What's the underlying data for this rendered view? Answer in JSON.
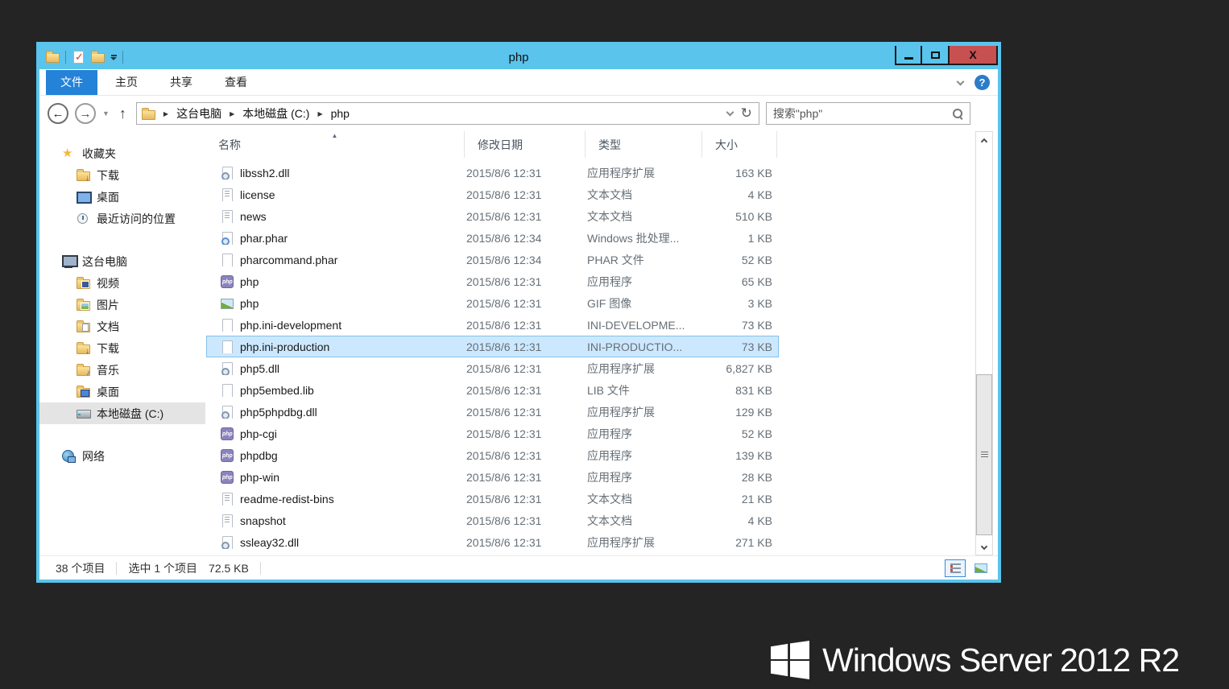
{
  "window": {
    "title": "php"
  },
  "titlebar": {
    "qat_icons": [
      "window-folder-icon",
      "properties-check-icon",
      "new-folder-icon",
      "qat-dropdown-caret"
    ],
    "controls": [
      "minimize",
      "maximize",
      "close"
    ]
  },
  "tabs": [
    {
      "label": "文件",
      "active": true
    },
    {
      "label": "主页",
      "active": false
    },
    {
      "label": "共享",
      "active": false
    },
    {
      "label": "查看",
      "active": false
    }
  ],
  "nav": {
    "breadcrumb": [
      "这台电脑",
      "本地磁盘 (C:)",
      "php"
    ],
    "search_placeholder": "搜索\"php\""
  },
  "sidebar": {
    "items": [
      {
        "label": "收藏夹",
        "icon": "star",
        "level": 0,
        "section": false,
        "selected": false
      },
      {
        "label": "下载",
        "icon": "folder-down",
        "level": 1,
        "section": false,
        "selected": false
      },
      {
        "label": "桌面",
        "icon": "monitor",
        "level": 1,
        "section": false,
        "selected": false
      },
      {
        "label": "最近访问的位置",
        "icon": "recent",
        "level": 1,
        "section": false,
        "selected": false
      },
      {
        "label": "这台电脑",
        "icon": "computer",
        "level": 0,
        "section": true,
        "selected": false
      },
      {
        "label": "视频",
        "icon": "folder-video",
        "level": 1,
        "section": false,
        "selected": false
      },
      {
        "label": "图片",
        "icon": "folder-pic",
        "level": 1,
        "section": false,
        "selected": false
      },
      {
        "label": "文档",
        "icon": "folder-doc",
        "level": 1,
        "section": false,
        "selected": false
      },
      {
        "label": "下载",
        "icon": "folder-down",
        "level": 1,
        "section": false,
        "selected": false
      },
      {
        "label": "音乐",
        "icon": "folder-music",
        "level": 1,
        "section": false,
        "selected": false
      },
      {
        "label": "桌面",
        "icon": "folder-desktop",
        "level": 1,
        "section": false,
        "selected": false
      },
      {
        "label": "本地磁盘 (C:)",
        "icon": "drive",
        "level": 1,
        "section": false,
        "selected": true
      },
      {
        "label": "网络",
        "icon": "network",
        "level": 0,
        "section": true,
        "selected": false
      }
    ]
  },
  "filelist": {
    "columns": [
      {
        "label": "名称",
        "sort": "asc"
      },
      {
        "label": "修改日期",
        "sort": null
      },
      {
        "label": "类型",
        "sort": null
      },
      {
        "label": "大小",
        "sort": null
      }
    ],
    "rows": [
      {
        "name": "libssh2.dll",
        "date": "2015/8/6 12:31",
        "type": "应用程序扩展",
        "size": "163 KB",
        "icon": "dll",
        "selected": false
      },
      {
        "name": "license",
        "date": "2015/8/6 12:31",
        "type": "文本文档",
        "size": "4 KB",
        "icon": "txt",
        "selected": false
      },
      {
        "name": "news",
        "date": "2015/8/6 12:31",
        "type": "文本文档",
        "size": "510 KB",
        "icon": "txt",
        "selected": false
      },
      {
        "name": "phar.phar",
        "date": "2015/8/6 12:34",
        "type": "Windows 批处理...",
        "size": "1 KB",
        "icon": "gearblue",
        "selected": false
      },
      {
        "name": "pharcommand.phar",
        "date": "2015/8/6 12:34",
        "type": "PHAR 文件",
        "size": "52 KB",
        "icon": "file",
        "selected": false
      },
      {
        "name": "php",
        "date": "2015/8/6 12:31",
        "type": "应用程序",
        "size": "65 KB",
        "icon": "php",
        "selected": false
      },
      {
        "name": "php",
        "date": "2015/8/6 12:31",
        "type": "GIF 图像",
        "size": "3 KB",
        "icon": "img",
        "selected": false
      },
      {
        "name": "php.ini-development",
        "date": "2015/8/6 12:31",
        "type": "INI-DEVELOPME...",
        "size": "73 KB",
        "icon": "file",
        "selected": false
      },
      {
        "name": "php.ini-production",
        "date": "2015/8/6 12:31",
        "type": "INI-PRODUCTIO...",
        "size": "73 KB",
        "icon": "file",
        "selected": true
      },
      {
        "name": "php5.dll",
        "date": "2015/8/6 12:31",
        "type": "应用程序扩展",
        "size": "6,827 KB",
        "icon": "dll",
        "selected": false
      },
      {
        "name": "php5embed.lib",
        "date": "2015/8/6 12:31",
        "type": "LIB 文件",
        "size": "831 KB",
        "icon": "file",
        "selected": false
      },
      {
        "name": "php5phpdbg.dll",
        "date": "2015/8/6 12:31",
        "type": "应用程序扩展",
        "size": "129 KB",
        "icon": "dll",
        "selected": false
      },
      {
        "name": "php-cgi",
        "date": "2015/8/6 12:31",
        "type": "应用程序",
        "size": "52 KB",
        "icon": "php",
        "selected": false
      },
      {
        "name": "phpdbg",
        "date": "2015/8/6 12:31",
        "type": "应用程序",
        "size": "139 KB",
        "icon": "php",
        "selected": false
      },
      {
        "name": "php-win",
        "date": "2015/8/6 12:31",
        "type": "应用程序",
        "size": "28 KB",
        "icon": "php",
        "selected": false
      },
      {
        "name": "readme-redist-bins",
        "date": "2015/8/6 12:31",
        "type": "文本文档",
        "size": "21 KB",
        "icon": "txt",
        "selected": false
      },
      {
        "name": "snapshot",
        "date": "2015/8/6 12:31",
        "type": "文本文档",
        "size": "4 KB",
        "icon": "txt",
        "selected": false
      },
      {
        "name": "ssleay32.dll",
        "date": "2015/8/6 12:31",
        "type": "应用程序扩展",
        "size": "271 KB",
        "icon": "dll",
        "selected": false
      }
    ]
  },
  "statusbar": {
    "items_count": "38 个项目",
    "selection": "选中 1 个项目",
    "selection_size": "72.5 KB"
  },
  "branding": {
    "text": "Windows Server 2012 R2"
  },
  "colors": {
    "titlebar_blue": "#5ac4ec",
    "active_tab_blue": "#2482d8",
    "selection_bg": "#cce8ff",
    "selection_border": "#84c0ea",
    "close_red": "#c75050",
    "folder_yellow": "#e9b95e",
    "php_purple": "#8a83bd",
    "desktop_dark": "#242424"
  }
}
